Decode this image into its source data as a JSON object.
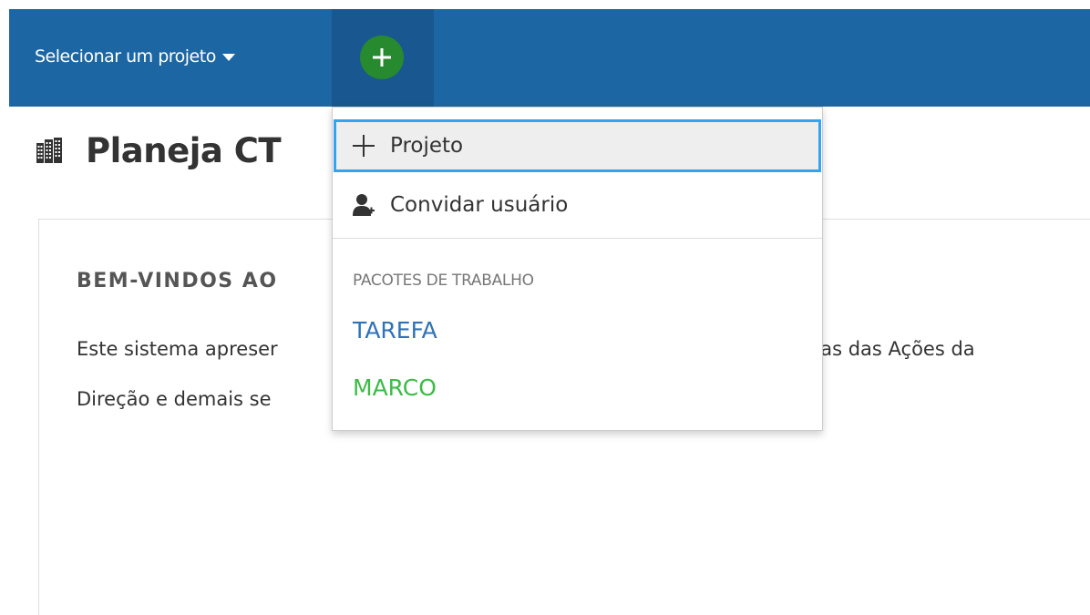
{
  "topbar": {
    "project_select_label": "Selecionar um projeto",
    "add_button_label": "+"
  },
  "page": {
    "title": "Planeja CT"
  },
  "card": {
    "heading": "BEM-VINDOS AO",
    "line1_start": "Este sistema apreser",
    "line1_end": "tas das Ações da",
    "line2_start": "Direção e demais se"
  },
  "dropdown": {
    "items": [
      {
        "label": "Projeto",
        "icon": "plus-icon"
      },
      {
        "label": "Convidar usuário",
        "icon": "add-user-icon"
      }
    ],
    "section_label": "PACOTES DE TRABALHO",
    "work_packages": [
      {
        "label": "TAREFA",
        "color": "#2f73b7"
      },
      {
        "label": "MARCO",
        "color": "#3dbb47"
      }
    ]
  },
  "colors": {
    "header_bg": "#1c67a3",
    "add_button_bg": "#288a2f",
    "focus_border": "#35a3ef"
  }
}
